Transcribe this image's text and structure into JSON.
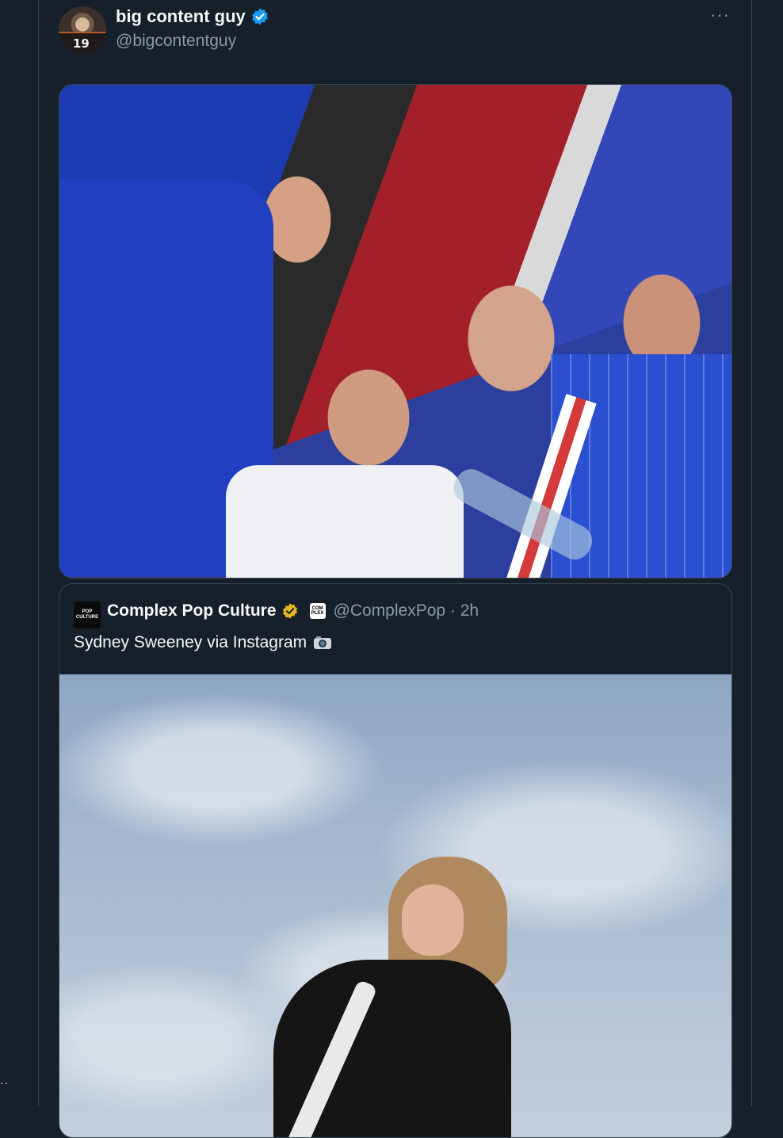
{
  "tweet": {
    "author": {
      "display_name": "big content guy",
      "handle": "@bigcontentguy",
      "avatar_jersey_number": "19",
      "verified_color": "#1d9bf0"
    },
    "more_menu_label": "···",
    "media": {
      "type": "photo"
    }
  },
  "quoted_tweet": {
    "author": {
      "display_name": "Complex Pop Culture",
      "avatar_text": "POP CULTURE",
      "affiliate_badge_text": "COM PLEX",
      "handle_and_time": "@ComplexPop · 2h",
      "verified_color": "#e2b719"
    },
    "text": "Sydney Sweeney via Instagram",
    "emoji_icon": "camera-icon",
    "media": {
      "type": "photo"
    }
  },
  "sidebar": {
    "overflow_label": "··"
  },
  "colors": {
    "background": "#15202b",
    "border": "#38444d",
    "text_primary": "#f7f9f9",
    "text_secondary": "#8b98a5"
  }
}
